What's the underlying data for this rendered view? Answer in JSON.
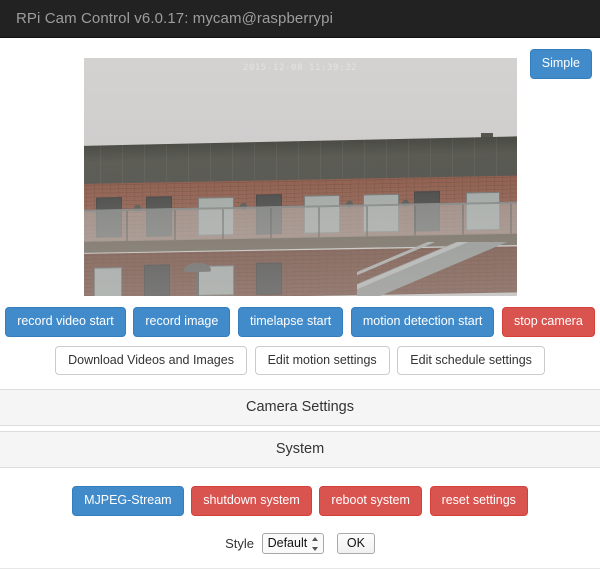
{
  "header": {
    "title": "RPi Cam Control v6.0.17: mycam@raspberrypi"
  },
  "toolbar": {
    "simple_label": "Simple"
  },
  "preview": {
    "timestamp": "2015-12-08 11:39:32",
    "alt": "live camera preview of brick building"
  },
  "controls": {
    "primary_row": [
      {
        "label": "record video start",
        "style": "primary"
      },
      {
        "label": "record image",
        "style": "primary"
      },
      {
        "label": "timelapse start",
        "style": "primary"
      },
      {
        "label": "motion detection start",
        "style": "primary"
      },
      {
        "label": "stop camera",
        "style": "danger"
      }
    ],
    "secondary_row": [
      {
        "label": "Download Videos and Images",
        "style": "default"
      },
      {
        "label": "Edit motion settings",
        "style": "default"
      },
      {
        "label": "Edit schedule settings",
        "style": "default"
      }
    ]
  },
  "panels": [
    {
      "title": "Camera Settings"
    },
    {
      "title": "System"
    }
  ],
  "system": {
    "buttons": [
      {
        "label": "MJPEG-Stream",
        "style": "primary"
      },
      {
        "label": "shutdown system",
        "style": "danger"
      },
      {
        "label": "reboot system",
        "style": "danger"
      },
      {
        "label": "reset settings",
        "style": "danger"
      }
    ]
  },
  "style_form": {
    "label": "Style",
    "selected": "Default",
    "options": [
      "Default"
    ],
    "ok_label": "OK"
  },
  "colors": {
    "navbar_bg": "#222222",
    "navbar_text": "#9d9d9d",
    "primary": "#428bca",
    "danger": "#d9534f",
    "panel_bg": "#f5f5f5",
    "panel_border": "#dddddd"
  }
}
